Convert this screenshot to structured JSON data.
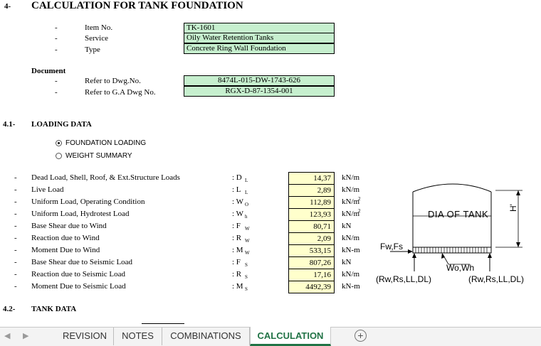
{
  "header": {
    "section_no": "4-",
    "title": "CALCULATION FOR TANK FOUNDATION"
  },
  "info": [
    {
      "dash": "-",
      "label": "Item No.",
      "value": "TK-1601"
    },
    {
      "dash": "-",
      "label": "Service",
      "value": "Oily Water Retention Tanks"
    },
    {
      "dash": "-",
      "label": "Type",
      "value": "Concrete Ring Wall Foundation"
    }
  ],
  "document": {
    "heading": "Document",
    "rows": [
      {
        "dash": "-",
        "label": "Refer to Dwg.No.",
        "value": "8474L-015-DW-1743-626"
      },
      {
        "dash": "-",
        "label": "Refer to G.A Dwg No.",
        "value": "RGX-D-87-1354-001"
      }
    ]
  },
  "loading": {
    "section_no": "4.1-",
    "heading": "LOADING DATA",
    "options": [
      {
        "label": "FOUNDATION LOADING",
        "selected": true
      },
      {
        "label": "WEIGHT SUMMARY",
        "selected": false
      }
    ],
    "rows": [
      {
        "dash": "-",
        "label": "Dead Load, Shell, Roof, & Ext.Structure Loads",
        "sym": ": D",
        "sub": "L",
        "value": "14,37",
        "unit": "kN/m",
        "sup": ""
      },
      {
        "dash": "-",
        "label": "Live Load",
        "sym": ": L",
        "sub": "L",
        "value": "2,89",
        "unit": "kN/m",
        "sup": ""
      },
      {
        "dash": "-",
        "label": "Uniform Load, Operating Condition",
        "sym": ": W",
        "sub": "O",
        "value": "112,89",
        "unit": "kN/m",
        "sup": "2"
      },
      {
        "dash": "-",
        "label": "Uniform Load, Hydrotest Load",
        "sym": ": W",
        "sub": "h",
        "value": "123,93",
        "unit": "kN/m",
        "sup": "2"
      },
      {
        "dash": "-",
        "label": "Base Shear due to Wind",
        "sym": ": F",
        "sub": "W",
        "value": "80,71",
        "unit": "kN",
        "sup": ""
      },
      {
        "dash": "-",
        "label": "Reaction due to Wind",
        "sym": ": R",
        "sub": "W",
        "value": "2,09",
        "unit": "kN/m",
        "sup": ""
      },
      {
        "dash": "-",
        "label": "Moment Due to Wind",
        "sym": ": M",
        "sub": "W",
        "value": "533,15",
        "unit": "kN-m",
        "sup": ""
      },
      {
        "dash": "-",
        "label": "Base Shear due to Seismic Load",
        "sym": ": F",
        "sub": "S",
        "value": "807,26",
        "unit": "kN",
        "sup": ""
      },
      {
        "dash": "-",
        "label": "Reaction due to Seismic Load",
        "sym": ": R",
        "sub": "S",
        "value": "17,16",
        "unit": "kN/m",
        "sup": ""
      },
      {
        "dash": "-",
        "label": "Moment Due to Seismic Load",
        "sym": ": M",
        "sub": "S",
        "value": "4492,39",
        "unit": "kN-m",
        "sup": ""
      }
    ]
  },
  "tank": {
    "section_no": "4.2-",
    "heading": "TANK DATA"
  },
  "diagram": {
    "dia_label": "DIA OF TANK",
    "height_label": "H'",
    "force_label": "Fw,Fs",
    "weight_label": "Wo,Wh",
    "reaction_left": "(Rw,Rs,LL,DL)",
    "reaction_right": "(Rw,Rs,LL,DL)"
  },
  "tabbar": {
    "tabs": [
      {
        "label": "REVISION",
        "active": false
      },
      {
        "label": "NOTES",
        "active": false
      },
      {
        "label": "COMBINATIONS",
        "active": false
      },
      {
        "label": "CALCULATION",
        "active": true
      }
    ],
    "add_symbol": "+"
  },
  "colors": {
    "input_fill": "#c6efce",
    "value_fill": "#ffffcc",
    "active_tab": "#217346"
  }
}
